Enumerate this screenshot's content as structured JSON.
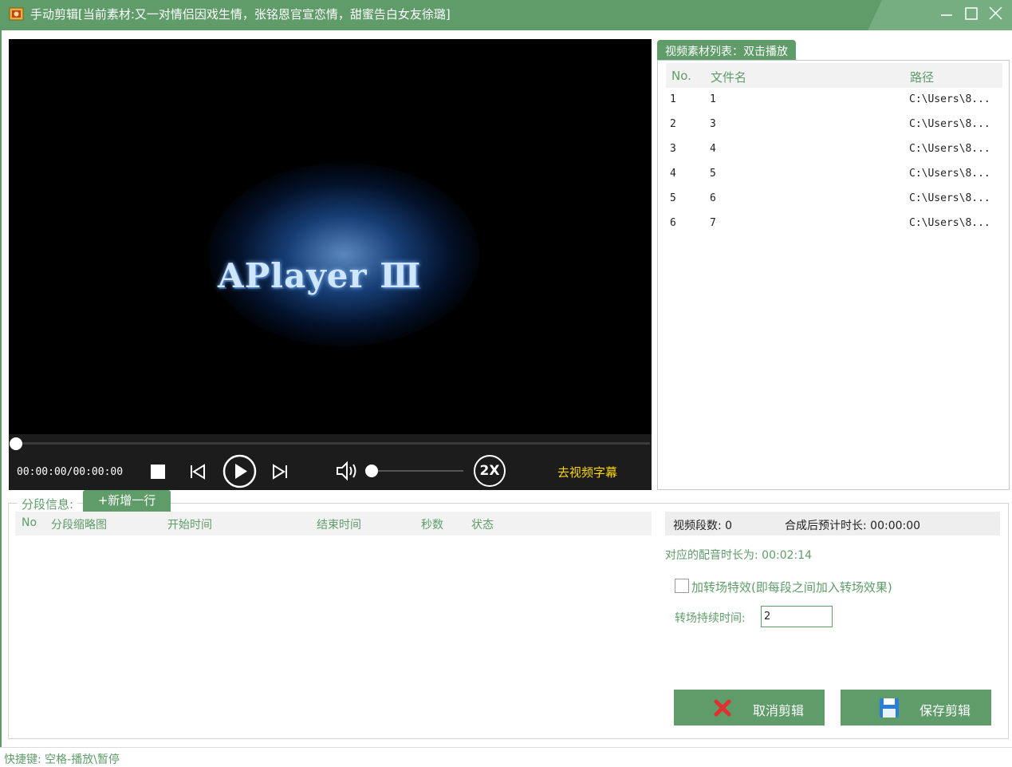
{
  "window": {
    "title": "手动剪辑[当前素材:又一对情侣因戏生情，张铭恩官宣恋情，甜蜜告白女友徐璐]"
  },
  "player": {
    "splash_text": "APlayer Ⅲ",
    "timecode": "00:00:00/00:00:00",
    "speed_label": "2X",
    "subtitle_link": "去视频字幕",
    "progress": 0,
    "volume": 0
  },
  "media_list": {
    "tab_label": "视频素材列表：双击播放",
    "columns": [
      "No.",
      "文件名",
      "路径"
    ],
    "rows": [
      {
        "no": "1",
        "name": "1",
        "path": "C:\\Users\\8..."
      },
      {
        "no": "2",
        "name": "3",
        "path": "C:\\Users\\8..."
      },
      {
        "no": "3",
        "name": "4",
        "path": "C:\\Users\\8..."
      },
      {
        "no": "4",
        "name": "5",
        "path": "C:\\Users\\8..."
      },
      {
        "no": "5",
        "name": "6",
        "path": "C:\\Users\\8..."
      },
      {
        "no": "6",
        "name": "7",
        "path": "C:\\Users\\8..."
      }
    ]
  },
  "segments": {
    "legend": "分段信息:",
    "add_row_label": "+新增一行",
    "columns": [
      "No",
      "分段缩略图",
      "开始时间",
      "结束时间",
      "秒数",
      "状态"
    ]
  },
  "stats": {
    "segment_count": "视频段数: 0",
    "estimated_duration": "合成后预计时长: 00:00:00",
    "dub_duration": "对应的配音时长为: 00:02:14"
  },
  "transition": {
    "checkbox_label": "加转场特效(即每段之间加入转场效果)",
    "checked": false,
    "duration_label": "转场持续时间:",
    "duration_value": "2"
  },
  "actions": {
    "cancel_label": "取消剪辑",
    "save_label": "保存剪辑"
  },
  "footer": {
    "shortcut_text": "快捷键: 空格-播放\\暂停"
  },
  "colors": {
    "accent": "#5f9c6a",
    "subtitle_link": "#ffd800",
    "cancel_icon": "#e0302f",
    "save_icon": "#2b7fd6"
  }
}
